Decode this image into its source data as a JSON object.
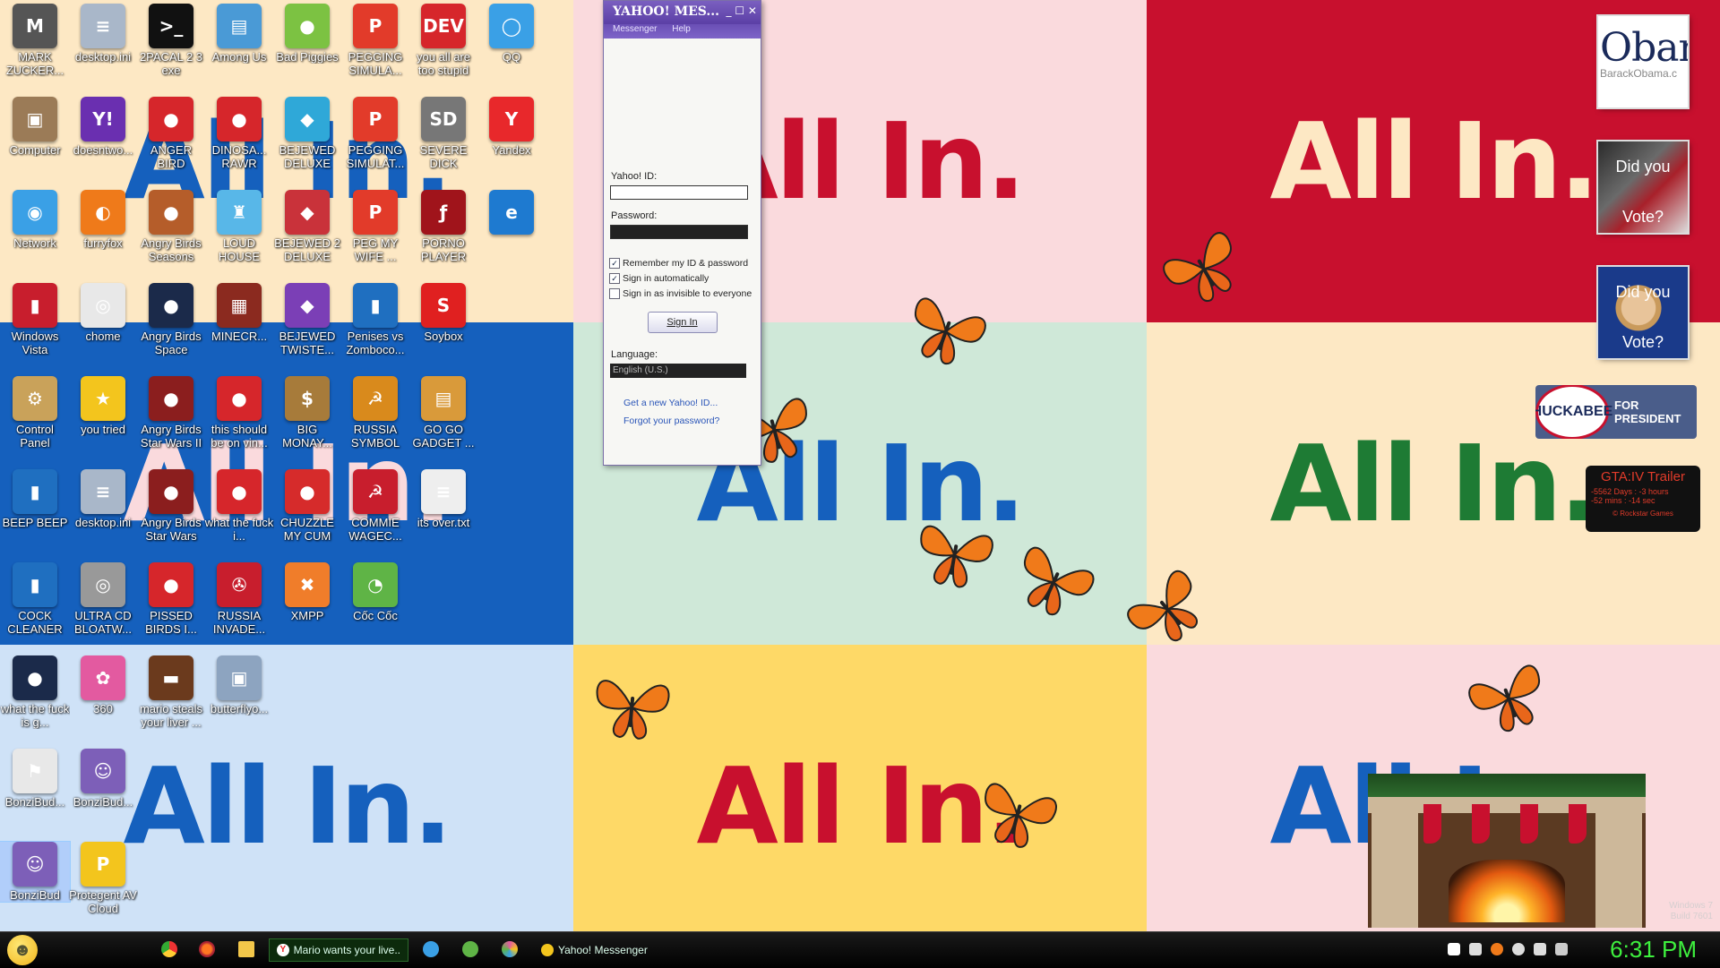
{
  "wallpaper": {
    "slogan": "All In.",
    "panels": [
      {
        "bg": "#fde8c4",
        "fg": "#1560bd"
      },
      {
        "bg": "#fadadd",
        "fg": "#c8102e"
      },
      {
        "bg": "#c8102e",
        "fg": "#fde8c4"
      },
      {
        "bg": "#1560bd",
        "fg": "#fadadd"
      },
      {
        "bg": "#cfe8d8",
        "fg": "#1560bd"
      },
      {
        "bg": "#fde8c4",
        "fg": "#1e7b34"
      },
      {
        "bg": "#cfe2f7",
        "fg": "#1560bd"
      },
      {
        "bg": "#fed967",
        "fg": "#c8102e"
      },
      {
        "bg": "#fadadd",
        "fg": "#1560bd"
      }
    ]
  },
  "desktop_icons": [
    {
      "label": "MARK ZUCKER...",
      "color": "#555",
      "glyph": "M"
    },
    {
      "label": "desktop.ini",
      "color": "#a9b7c9",
      "glyph": "≡"
    },
    {
      "label": "2PACAL 2 3 exe",
      "color": "#111",
      "glyph": ">_"
    },
    {
      "label": "Among Us",
      "color": "#4a9ad6",
      "glyph": "▤"
    },
    {
      "label": "Bad Piggies",
      "color": "#7cc242",
      "glyph": "●"
    },
    {
      "label": "PEGGING SIMULA...",
      "color": "#e23b2a",
      "glyph": "P"
    },
    {
      "label": "you all are too stupid",
      "color": "#d6262b",
      "glyph": "DEV"
    },
    {
      "label": "QQ",
      "color": "#3aa0e6",
      "glyph": "◯"
    },
    {
      "label": "Computer",
      "color": "#9b7b57",
      "glyph": "▣"
    },
    {
      "label": "doesntwo...",
      "color": "#6a2fb0",
      "glyph": "Y!"
    },
    {
      "label": "ANGER BIRD",
      "color": "#d6262b",
      "glyph": "●"
    },
    {
      "label": "DINOSA... RAWR",
      "color": "#d6262b",
      "glyph": "●"
    },
    {
      "label": "BEJEWED DELUXE",
      "color": "#2fa8d8",
      "glyph": "◆"
    },
    {
      "label": "PEGGING SIMULAT...",
      "color": "#e23b2a",
      "glyph": "P"
    },
    {
      "label": "SEVERE DICK",
      "color": "#777",
      "glyph": "SD"
    },
    {
      "label": "Yandex",
      "color": "#e8282b",
      "glyph": "Y"
    },
    {
      "label": "Network",
      "color": "#3aa0e6",
      "glyph": "◉"
    },
    {
      "label": "furryfox",
      "color": "#ef7a1a",
      "glyph": "◐"
    },
    {
      "label": "Angry Birds Seasons",
      "color": "#b55d2a",
      "glyph": "●"
    },
    {
      "label": "LOUD HOUSE",
      "color": "#58b7e8",
      "glyph": "♜"
    },
    {
      "label": "BEJEWED 2 DELUXE",
      "color": "#c9323a",
      "glyph": "◆"
    },
    {
      "label": "PEG MY WIFE ...",
      "color": "#e23b2a",
      "glyph": "P"
    },
    {
      "label": "PORNO PLAYER",
      "color": "#a0141b",
      "glyph": "ƒ"
    },
    {
      "label": "",
      "color": "#1e7ad0",
      "glyph": "e"
    },
    {
      "label": "Windows Vista",
      "color": "#c81e2d",
      "glyph": "▮"
    },
    {
      "label": "chome",
      "color": "#e8e8e8",
      "glyph": "◎"
    },
    {
      "label": "Angry Birds Space",
      "color": "#1b2a4a",
      "glyph": "●"
    },
    {
      "label": "MINECR...",
      "color": "#8b2a1f",
      "glyph": "▦"
    },
    {
      "label": "BEJEWED TWISTE...",
      "color": "#7b3fb6",
      "glyph": "◆"
    },
    {
      "label": "Penises vs Zomboco...",
      "color": "#1f6fc0",
      "glyph": "▮"
    },
    {
      "label": "Soybox",
      "color": "#e02020",
      "glyph": "S"
    },
    {
      "label": "",
      "color": "transparent",
      "glyph": ""
    },
    {
      "label": "Control Panel",
      "color": "#c9a25a",
      "glyph": "⚙"
    },
    {
      "label": "you tried",
      "color": "#f3c51d",
      "glyph": "★"
    },
    {
      "label": "Angry Birds Star Wars II",
      "color": "#8b1e1e",
      "glyph": "●"
    },
    {
      "label": "this should be on vin...",
      "color": "#d6262b",
      "glyph": "●"
    },
    {
      "label": "BIG MONAY...",
      "color": "#a77b3a",
      "glyph": "$"
    },
    {
      "label": "RUSSIA SYMBOL",
      "color": "#d98a1c",
      "glyph": "☭"
    },
    {
      "label": "GO GO GADGET ...",
      "color": "#d99a3a",
      "glyph": "▤"
    },
    {
      "label": "",
      "color": "transparent",
      "glyph": ""
    },
    {
      "label": "BEEP BEEP",
      "color": "#1f6fc0",
      "glyph": "▮"
    },
    {
      "label": "desktop.ini",
      "color": "#a9b7c9",
      "glyph": "≡"
    },
    {
      "label": "Angry Birds Star Wars",
      "color": "#8b1e1e",
      "glyph": "●"
    },
    {
      "label": "what the fuck i...",
      "color": "#d6262b",
      "glyph": "●"
    },
    {
      "label": "CHUZZLE MY CUM",
      "color": "#d62b2b",
      "glyph": "●"
    },
    {
      "label": "COMMIE WAGEC...",
      "color": "#c81e2d",
      "glyph": "☭"
    },
    {
      "label": "its over.txt",
      "color": "#eee",
      "glyph": "≡"
    },
    {
      "label": "",
      "color": "transparent",
      "glyph": ""
    },
    {
      "label": "COCK CLEANER",
      "color": "#1f6fc0",
      "glyph": "▮"
    },
    {
      "label": "ULTRA CD BLOATW...",
      "color": "#999",
      "glyph": "◎"
    },
    {
      "label": "PISSED BIRDS I...",
      "color": "#d6262b",
      "glyph": "●"
    },
    {
      "label": "RUSSIA INVADE...",
      "color": "#c81e2d",
      "glyph": "✇"
    },
    {
      "label": "XMPP",
      "color": "#f07d2a",
      "glyph": "✖"
    },
    {
      "label": "Cốc Cốc",
      "color": "#5fb446",
      "glyph": "◔"
    },
    {
      "label": "",
      "color": "transparent",
      "glyph": ""
    },
    {
      "label": "",
      "color": "transparent",
      "glyph": ""
    },
    {
      "label": "what the fuck is g...",
      "color": "#1b2a4a",
      "glyph": "●"
    },
    {
      "label": "360",
      "color": "#e35aa0",
      "glyph": "✿"
    },
    {
      "label": "mario steals your liver ...",
      "color": "#6b3a1d",
      "glyph": "▬"
    },
    {
      "label": "butterflyo...",
      "color": "#8da4c0",
      "glyph": "▣"
    },
    {
      "label": "",
      "color": "transparent",
      "glyph": ""
    },
    {
      "label": "",
      "color": "transparent",
      "glyph": ""
    },
    {
      "label": "",
      "color": "transparent",
      "glyph": ""
    },
    {
      "label": "",
      "color": "transparent",
      "glyph": ""
    },
    {
      "label": "BonziBud...",
      "color": "#e8e8e8",
      "glyph": "⚑"
    },
    {
      "label": "BonziBud...",
      "color": "#7d5fb8",
      "glyph": "☺"
    },
    {
      "label": "",
      "color": "transparent",
      "glyph": ""
    },
    {
      "label": "",
      "color": "transparent",
      "glyph": ""
    },
    {
      "label": "",
      "color": "transparent",
      "glyph": ""
    },
    {
      "label": "",
      "color": "transparent",
      "glyph": ""
    },
    {
      "label": "",
      "color": "transparent",
      "glyph": ""
    },
    {
      "label": "",
      "color": "transparent",
      "glyph": ""
    },
    {
      "label": "BonziBud",
      "color": "#7d5fb8",
      "glyph": "☺",
      "selected": true
    },
    {
      "label": "Protegent AV Cloud",
      "color": "#f3c51d",
      "glyph": "P"
    }
  ],
  "yahoo_window": {
    "title": "YAHOO! MES...",
    "controls": "_ ☐ ✕",
    "menu": [
      "Messenger",
      "Help"
    ],
    "id_label": "Yahoo! ID:",
    "id_value": "",
    "password_label": "Password:",
    "checkboxes": [
      {
        "label": "Remember my ID & password",
        "checked": true
      },
      {
        "label": "Sign in automatically",
        "checked": true
      },
      {
        "label": "Sign in as invisible to everyone",
        "checked": false
      }
    ],
    "sign_in": "Sign In",
    "language_label": "Language:",
    "language_value": "English (U.S.)",
    "link_new_id": "Get a new Yahoo! ID...",
    "link_forgot": "Forgot your password?"
  },
  "gadgets": {
    "obama_text": "Obar",
    "obama_sub": "BarackObama.c",
    "vote1_text": "Did you Vote?",
    "vote2_text": "Did you Vote?",
    "huckabee_name": "HUCKABEE",
    "huckabee_suffix": "FOR PRESIDENT",
    "gta_title": "GTA:IV Trailer",
    "gta_line1": "-5562 Days : -3 hours",
    "gta_line2": "-52 mins : -14 sec",
    "gta_footer": "© Rockstar Games"
  },
  "watermark": {
    "line1": "Windows 7",
    "line2": "Build 7601"
  },
  "taskbar": {
    "start_icon": "smiley-start-icon",
    "task1": "Mario wants your live...",
    "task2": "Yahoo! Messenger",
    "clock": "6:31 PM"
  },
  "colors": {
    "taskbar_bg": "#000000",
    "clock": "#3ef03e",
    "yahoo_purple": "#5b3fa6",
    "butterfly": "#f07a1a"
  }
}
